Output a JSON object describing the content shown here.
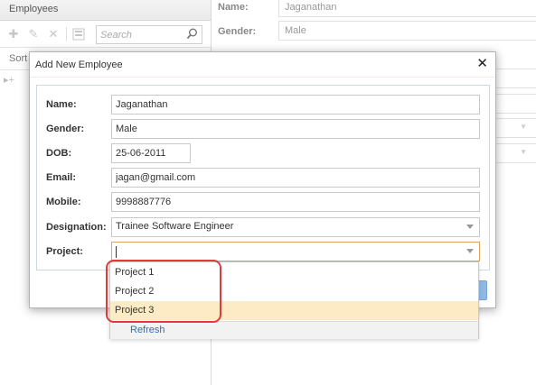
{
  "left_panel": {
    "title": "Employees",
    "search_placeholder": "Search",
    "sort_label": "Sort",
    "tree_expander": "▸+"
  },
  "toolbar_icons": [
    "add-icon",
    "edit-icon",
    "delete-icon",
    "export-icon"
  ],
  "details_panel": {
    "name_label": "Name:",
    "name_value": "Jaganathan",
    "gender_label": "Gender:",
    "gender_value": "Male"
  },
  "dialog": {
    "title": "Add New Employee",
    "close_glyph": "✕",
    "fields": {
      "name": {
        "label": "Name:",
        "value": "Jaganathan"
      },
      "gender": {
        "label": "Gender:",
        "value": "Male"
      },
      "dob": {
        "label": "DOB:",
        "value": "25-06-2011"
      },
      "email": {
        "label": "Email:",
        "value": "jagan@gmail.com"
      },
      "mobile": {
        "label": "Mobile:",
        "value": "9998887776"
      },
      "designation": {
        "label": "Designation:",
        "value": "Trainee Software Engineer"
      },
      "project": {
        "label": "Project:",
        "value": ""
      }
    }
  },
  "project_dropdown": {
    "options": [
      "Project 1",
      "Project 2",
      "Project 3"
    ],
    "highlighted_option": "Project 3",
    "footer_label": "Refresh"
  },
  "colors": {
    "focus_border": "#e3a35a",
    "highlight_bg": "#fcebc4",
    "annotation": "#e03a3a",
    "link": "#2f6fc0"
  }
}
